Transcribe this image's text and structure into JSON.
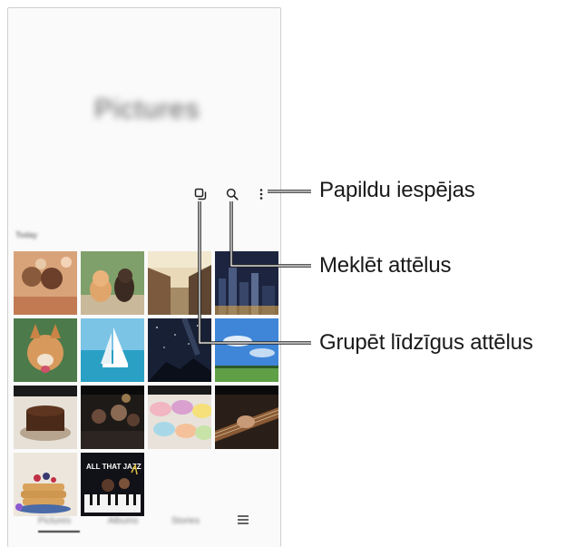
{
  "app": {
    "header_title": "Pictures",
    "section_label": "Today"
  },
  "toolbar": {
    "group_icon": "group-similar-icon",
    "search_icon": "search-icon",
    "more_icon": "more-options-icon"
  },
  "bottom_nav": {
    "tabs": [
      {
        "label": "Pictures",
        "active": true
      },
      {
        "label": "Albums",
        "active": false
      },
      {
        "label": "Stories",
        "active": false
      }
    ],
    "menu_icon": "hamburger-menu-icon"
  },
  "thumbnails": [
    {
      "subject": "friends-selfie"
    },
    {
      "subject": "kitten-and-puppy"
    },
    {
      "subject": "old-town-street"
    },
    {
      "subject": "city-skyline-night"
    },
    {
      "subject": "corgi-on-grass"
    },
    {
      "subject": "sailboat-sea"
    },
    {
      "subject": "starry-night-sky"
    },
    {
      "subject": "blue-sky-meadow"
    },
    {
      "subject": "chocolate-cake"
    },
    {
      "subject": "concert-crowd"
    },
    {
      "subject": "macarons"
    },
    {
      "subject": "guitar-player"
    },
    {
      "subject": "pancakes-berries"
    },
    {
      "subject": "all-that-jazz-poster"
    }
  ],
  "callouts": {
    "more_options": "Papildu iespējas",
    "search": "Meklēt attēlus",
    "group_similar": "Grupēt līdzīgus attēlus"
  },
  "colors": {
    "leader_line": "#222222",
    "screen_background": "#fafafa"
  }
}
